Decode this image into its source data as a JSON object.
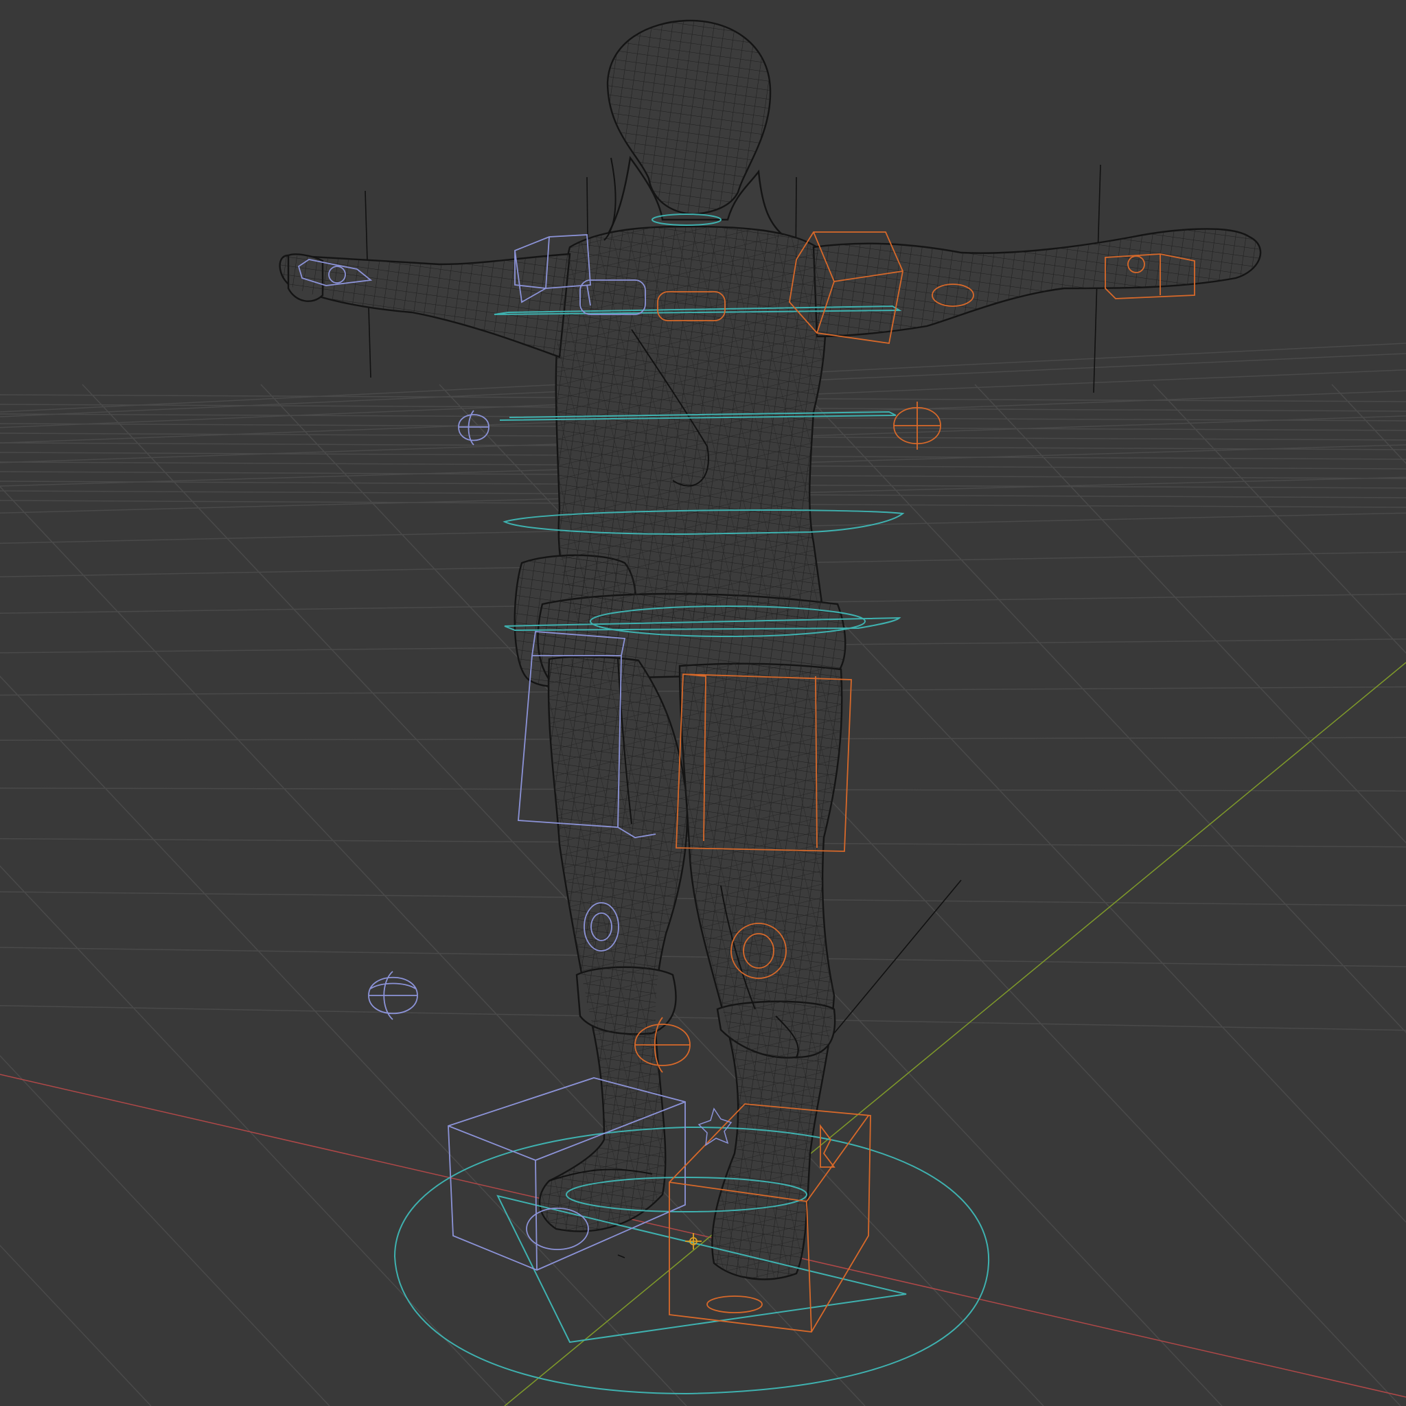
{
  "viewport": {
    "shading_mode": "wireframe",
    "background_color": "#393939"
  },
  "colors": {
    "grid_line": "#4a4a4a",
    "axis_x": "#b04848",
    "axis_y": "#7f9a2a",
    "mesh_wire": "#161616",
    "ctrl_left": "#8c93d8",
    "ctrl_right": "#d8692a",
    "ctrl_center": "#3fb2b0",
    "pole_line": "#111111"
  },
  "scene": {
    "object": "character-mesh",
    "pose": "T-pose",
    "rig_controls": [
      "ik-box-controls",
      "pole-target-controls",
      "torso-ring-controls",
      "root-circle-control"
    ]
  }
}
